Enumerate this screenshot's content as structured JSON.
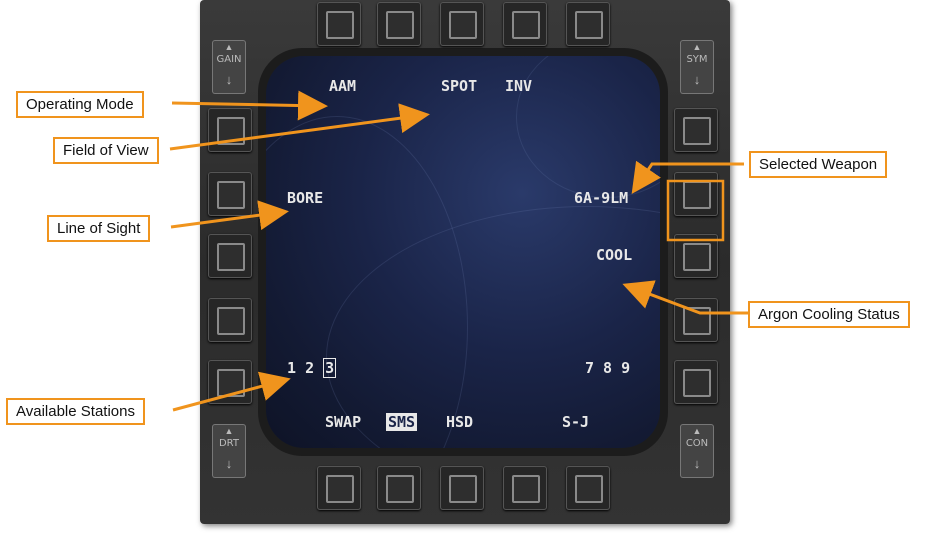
{
  "mfd": {
    "top_labels": {
      "mode": "AAM",
      "fov": "SPOT",
      "polarity": "INV"
    },
    "left_labels": {
      "los": "BORE"
    },
    "right_labels": {
      "weapon": "6A-9LM",
      "cooling": "COOL"
    },
    "stations_left": [
      "1",
      "2",
      "3"
    ],
    "stations_right": "7 8 9",
    "bottom_labels": {
      "swap": "SWAP",
      "sms": "SMS",
      "hsd": "HSD",
      "sj": "S-J"
    },
    "rockers": {
      "gain": "GAIN",
      "sym": "SYM",
      "drt": "DRT",
      "con": "CON"
    }
  },
  "callouts": {
    "operating_mode": "Operating Mode",
    "field_of_view": "Field of View",
    "line_of_sight": "Line of Sight",
    "available_stations": "Available Stations",
    "selected_weapon": "Selected Weapon",
    "argon_cooling": "Argon Cooling Status"
  },
  "colors": {
    "callout_border": "#f0941d",
    "screen": "#1a2448"
  }
}
